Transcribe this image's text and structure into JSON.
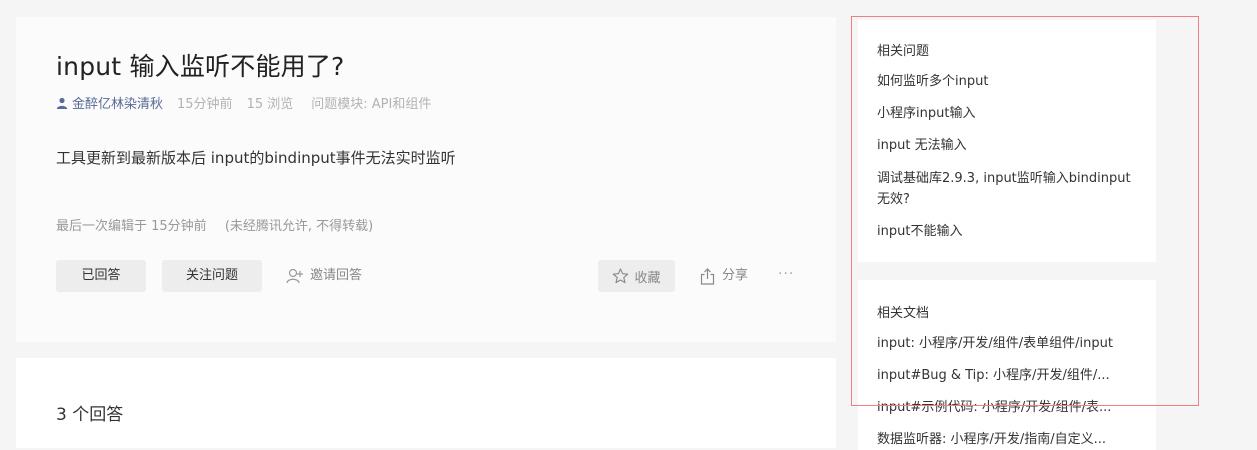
{
  "question": {
    "title": "input 输入监听不能用了?",
    "author": "金醉亿林染清秋",
    "time": "15分钟前",
    "views": "15 浏览",
    "module": "问题模块:  API和组件",
    "body": "工具更新到最新版本后 input的bindinput事件无法实时监听",
    "edit_time": "最后一次编辑于  15分钟前",
    "edit_notice": "(未经腾讯允许, 不得转载)"
  },
  "actions": {
    "answered": "已回答",
    "follow": "关注问题",
    "invite": "邀请回答",
    "collect": "收藏",
    "share": "分享",
    "more": "···"
  },
  "answers": {
    "count_label": "3 个回答"
  },
  "sidebar": {
    "related_questions_title": "相关问题",
    "related_questions": [
      "如何监听多个input",
      "小程序input输入",
      "input 无法输入",
      "调试基础库2.9.3, input监听输入bindinput无效?",
      "input不能输入"
    ],
    "related_docs_title": "相关文档",
    "related_docs": [
      "input: 小程序/开发/组件/表单组件/input",
      "input#Bug & Tip: 小程序/开发/组件/...",
      "input#示例代码: 小程序/开发/组件/表...",
      "数据监听器: 小程序/开发/指南/自定义..."
    ]
  },
  "colors": {
    "author_link": "#576b95",
    "button_bg": "#ededed",
    "highlight_border": "#f08080"
  },
  "icons": [
    "user-icon",
    "add-user-icon",
    "star-icon",
    "share-icon"
  ]
}
